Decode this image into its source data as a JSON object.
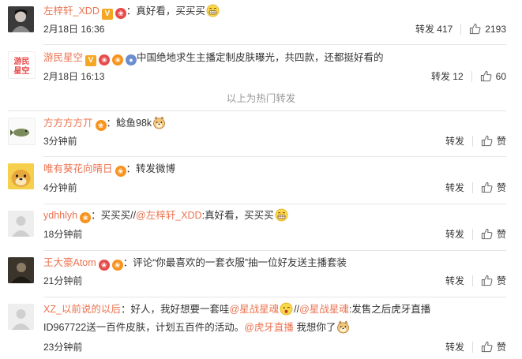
{
  "hot_header": "以上为热门转发",
  "actions": {
    "repost": "转发",
    "like": "赞"
  },
  "comments": [
    {
      "name": "左梓轩_XDD",
      "text": "：真好看，买买买",
      "time": "2月18日 16:36",
      "repost_label": "转发 417",
      "like_count": "2193"
    },
    {
      "name": "游民星空",
      "text": "中国绝地求生主播定制皮肤曝光，共四款，还都挺好看的",
      "time": "2月18日 16:13",
      "repost_label": "转发 12",
      "like_count": "60"
    },
    {
      "name": "方方方方丌",
      "text": "：鲶鱼98k",
      "time": "3分钟前"
    },
    {
      "name": "唯有葵花向晴日",
      "text": "：转发微博",
      "time": "4分钟前"
    },
    {
      "name": "ydhhlyh",
      "text_a": "：买买买//",
      "mention": "@左梓轩_XDD",
      "text_b": ":真好看，买买买",
      "time": "18分钟前"
    },
    {
      "name": "王大豪Atom",
      "text": "：评论“你最喜欢的一套衣服”抽一位好友送主播套装",
      "time": "21分钟前"
    },
    {
      "name": "XZ_以前说的以后",
      "text_a": "：好人，我好想要一套哇",
      "mention1": "@星战星魂",
      "text_b": "//",
      "mention2": "@星战星魂",
      "text_c": ":发售之后虎牙直播",
      "line2_a": "ID967722送一百件皮肤，计划五百件的活动。",
      "mention3": "@虎牙直播",
      "line2_b": " 我想你了",
      "time": "23分钟前"
    }
  ]
}
